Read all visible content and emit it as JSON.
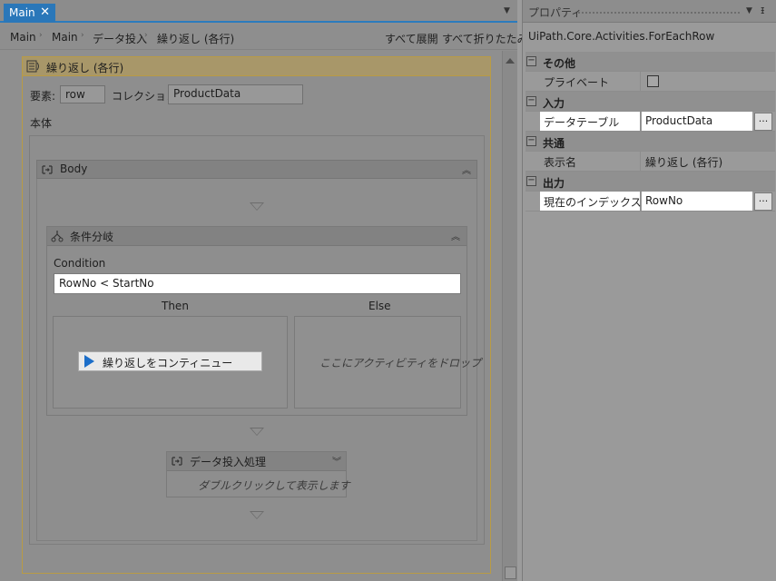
{
  "tab": {
    "label": "Main",
    "close": "✕"
  },
  "breadcrumb": [
    "Main",
    "Main",
    "データ投入",
    "繰り返し (各行)"
  ],
  "toolbar": {
    "expand_all": "すべて展開",
    "collapse_all": "すべて折りたたみ"
  },
  "foreach": {
    "title": "繰り返し (各行)",
    "item_label": "要素:",
    "item_value": "row",
    "collection_label": "コレクション:",
    "collection_value": "ProductData",
    "body_label": "本体"
  },
  "body_sequence": {
    "title": "Body"
  },
  "if_activity": {
    "title": "条件分岐",
    "condition_label": "Condition",
    "condition_value": "RowNo < StartNo",
    "then_label": "Then",
    "else_label": "Else",
    "then_activity": "繰り返しをコンティニュー",
    "else_placeholder": "ここにアクティビティをドロップ"
  },
  "invoke_activity": {
    "title": "データ投入処理",
    "hint": "ダブルクリックして表示します"
  },
  "properties": {
    "title": "プロパティ",
    "type_name": "UiPath.Core.Activities.ForEachRow",
    "categories": [
      {
        "label": "その他",
        "rows": [
          {
            "name": "プライベート",
            "value": ""
          }
        ]
      },
      {
        "label": "入力",
        "rows": [
          {
            "name": "データテーブル",
            "value": "ProductData"
          }
        ]
      },
      {
        "label": "共通",
        "rows": [
          {
            "name": "表示名",
            "value": "繰り返し (各行)"
          }
        ]
      },
      {
        "label": "出力",
        "rows": [
          {
            "name": "現在のインデックス",
            "value": "RowNo"
          }
        ]
      }
    ],
    "ellipsis": "..."
  },
  "icons": [
    "foreach-icon",
    "sequence-icon",
    "if-icon",
    "invoke-icon",
    "play-icon",
    "pin-icon",
    "chevron-up-icon",
    "chevron-down-icon"
  ],
  "colors": {
    "tab_accent": "#2a77b9",
    "foreach_header": "#a89769",
    "continue_icon": "#1c6ec9"
  }
}
